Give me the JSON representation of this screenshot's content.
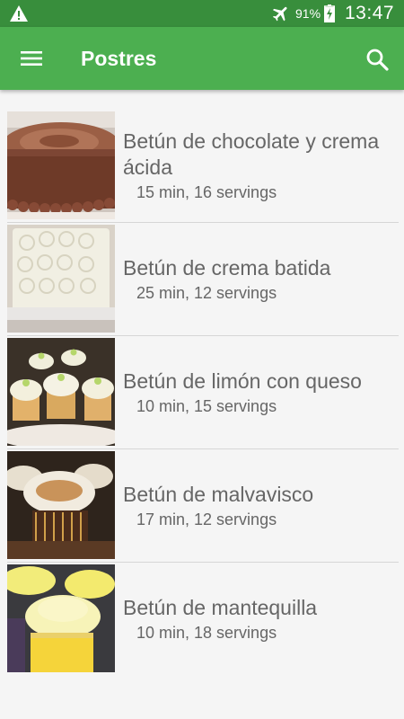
{
  "status_bar": {
    "battery": "91%",
    "time": "13:47",
    "icons": [
      "warning-icon",
      "airplane-icon",
      "battery-charging-icon"
    ]
  },
  "app_bar": {
    "title": "Postres",
    "icons": [
      "menu-icon",
      "search-icon"
    ],
    "color": "#4caf50",
    "status_color": "#388e3c"
  },
  "recipes": [
    {
      "name": "Betún de chocolate y crema ácida",
      "meta": "15 min, 16 servings",
      "image": "chocolate-cake-photo"
    },
    {
      "name": "Betún de crema batida",
      "meta": "25 min, 12 servings",
      "image": "rose-cream-cake-photo"
    },
    {
      "name": "Betún de limón con queso",
      "meta": "10 min, 15 servings",
      "image": "lemon-cupcakes-photo"
    },
    {
      "name": "Betún de malvavisco",
      "meta": "17 min, 12 servings",
      "image": "marshmallow-cupcakes-photo"
    },
    {
      "name": "Betún de mantequilla",
      "meta": "10 min, 18 servings",
      "image": "butter-cupcakes-photo"
    }
  ]
}
